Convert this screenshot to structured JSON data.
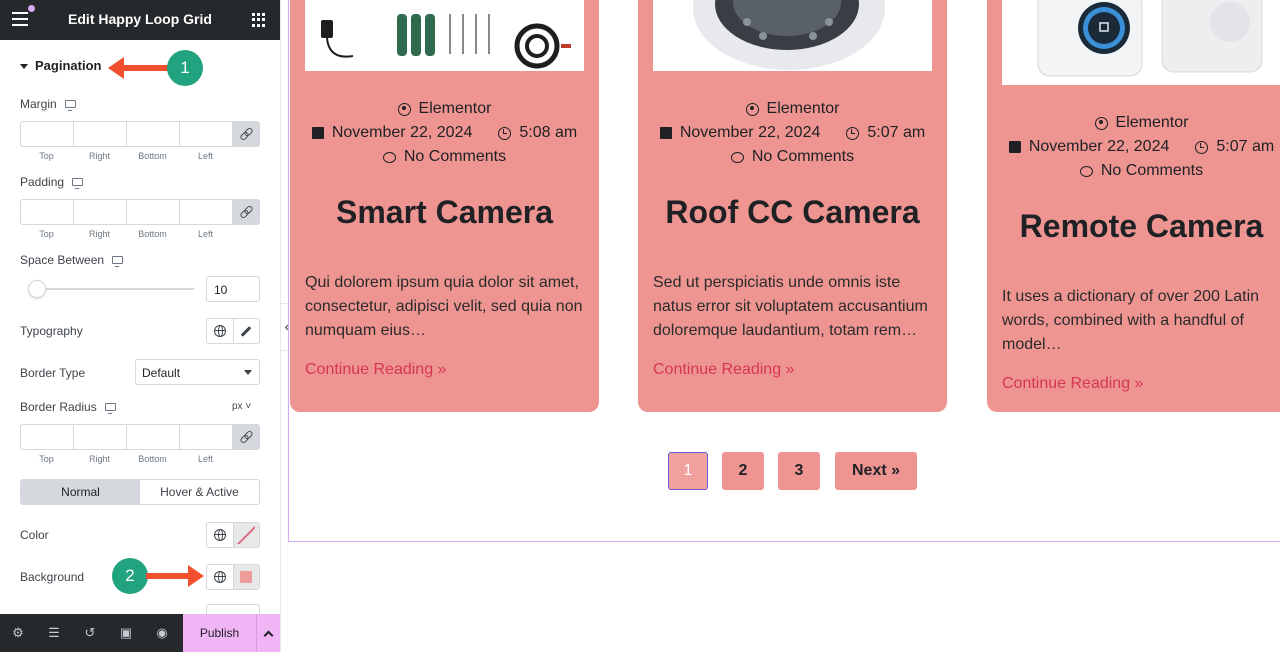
{
  "panel": {
    "title": "Edit Happy Loop Grid",
    "section": "Pagination",
    "margin_label": "Margin",
    "padding_label": "Padding",
    "space_between_label": "Space Between",
    "space_between_value": "10",
    "typography_label": "Typography",
    "border_type_label": "Border Type",
    "border_type_value": "Default",
    "border_radius_label": "Border Radius",
    "border_radius_unit": "px ˅",
    "dim_labels": {
      "top": "Top",
      "right": "Right",
      "bottom": "Bottom",
      "left": "Left"
    },
    "tab_normal": "Normal",
    "tab_hover": "Hover & Active",
    "color_label": "Color",
    "background_label": "Background",
    "background_color": "#ee9c9a",
    "publish_label": "Publish"
  },
  "annotations": {
    "badge1": "1",
    "badge2": "2",
    "arrow_color": "#f0502d",
    "badge_color": "#22a37f"
  },
  "cards": [
    {
      "author": "Elementor",
      "date": "November 22, 2024",
      "time": "5:08 am",
      "comments": "No Comments",
      "title": "Smart Camera",
      "excerpt": "Qui dolorem ipsum quia dolor sit amet, consectetur, adipisci velit, sed quia non numquam eius…",
      "link": "Continue Reading »"
    },
    {
      "author": "Elementor",
      "date": "November 22, 2024",
      "time": "5:07 am",
      "comments": "No Comments",
      "title": "Roof CC Camera",
      "excerpt": "Sed ut perspiciatis unde omnis iste natus error sit voluptatem accusantium doloremque laudantium, totam rem…",
      "link": "Continue Reading »"
    },
    {
      "author": "Elementor",
      "date": "November 22, 2024",
      "time": "5:07 am",
      "comments": "No Comments",
      "title": "Remote Camera",
      "excerpt": "It uses a dictionary of over 200 Latin words, combined with a handful of model…",
      "link": "Continue Reading »"
    }
  ],
  "pagination": {
    "pages": [
      "1",
      "2",
      "3"
    ],
    "current": "1",
    "next": "Next »"
  },
  "colors": {
    "card_bg": "#ee9592",
    "link": "#d63656",
    "accent": "#f0b5f5"
  }
}
